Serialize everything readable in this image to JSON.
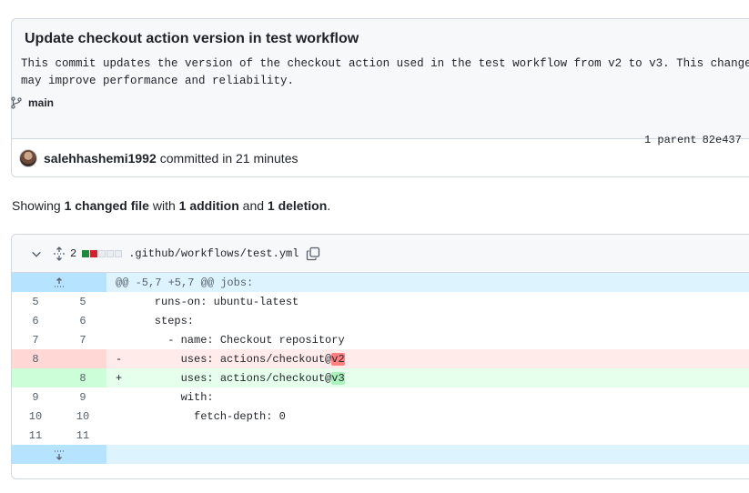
{
  "commit": {
    "title": "Update checkout action version in test workflow",
    "description": "This commit updates the version of the checkout action used in the test workflow from v2 to v3. This change\nmay improve performance and reliability.",
    "branch": "main",
    "author": "salehhashemi1992",
    "committed_text": "committed in 21 minutes",
    "parent_label": "1 parent",
    "parent_sha": "82e437"
  },
  "summary": {
    "prefix": "Showing ",
    "changed": "1 changed file",
    "with": " with ",
    "additions": "1 addition",
    "and": " and ",
    "deletions": "1 deletion",
    "suffix": "."
  },
  "file": {
    "change_count": "2",
    "path": ".github/workflows/test.yml",
    "diffstat": [
      "add",
      "del",
      "neutral",
      "neutral",
      "neutral"
    ],
    "hunk_header": "@@ -5,7 +5,7 @@ jobs:",
    "lines": [
      {
        "type": "ctx",
        "old": "5",
        "new": "5",
        "sign": " ",
        "text": "    runs-on: ubuntu-latest"
      },
      {
        "type": "ctx",
        "old": "6",
        "new": "6",
        "sign": " ",
        "text": "    steps:"
      },
      {
        "type": "ctx",
        "old": "7",
        "new": "7",
        "sign": " ",
        "text": "      - name: Checkout repository"
      },
      {
        "type": "del",
        "old": "8",
        "new": "",
        "sign": "-",
        "text": "        uses: actions/checkout@",
        "hl": "v2"
      },
      {
        "type": "add",
        "old": "",
        "new": "8",
        "sign": "+",
        "text": "        uses: actions/checkout@",
        "hl": "v3"
      },
      {
        "type": "ctx",
        "old": "9",
        "new": "9",
        "sign": " ",
        "text": "        with:"
      },
      {
        "type": "ctx",
        "old": "10",
        "new": "10",
        "sign": " ",
        "text": "          fetch-depth: 0"
      },
      {
        "type": "ctx",
        "old": "11",
        "new": "11",
        "sign": " ",
        "text": ""
      }
    ]
  },
  "colors": {
    "add_line": "#e6ffec",
    "del_line": "#ffebe9",
    "hunk": "#ddf4ff"
  }
}
